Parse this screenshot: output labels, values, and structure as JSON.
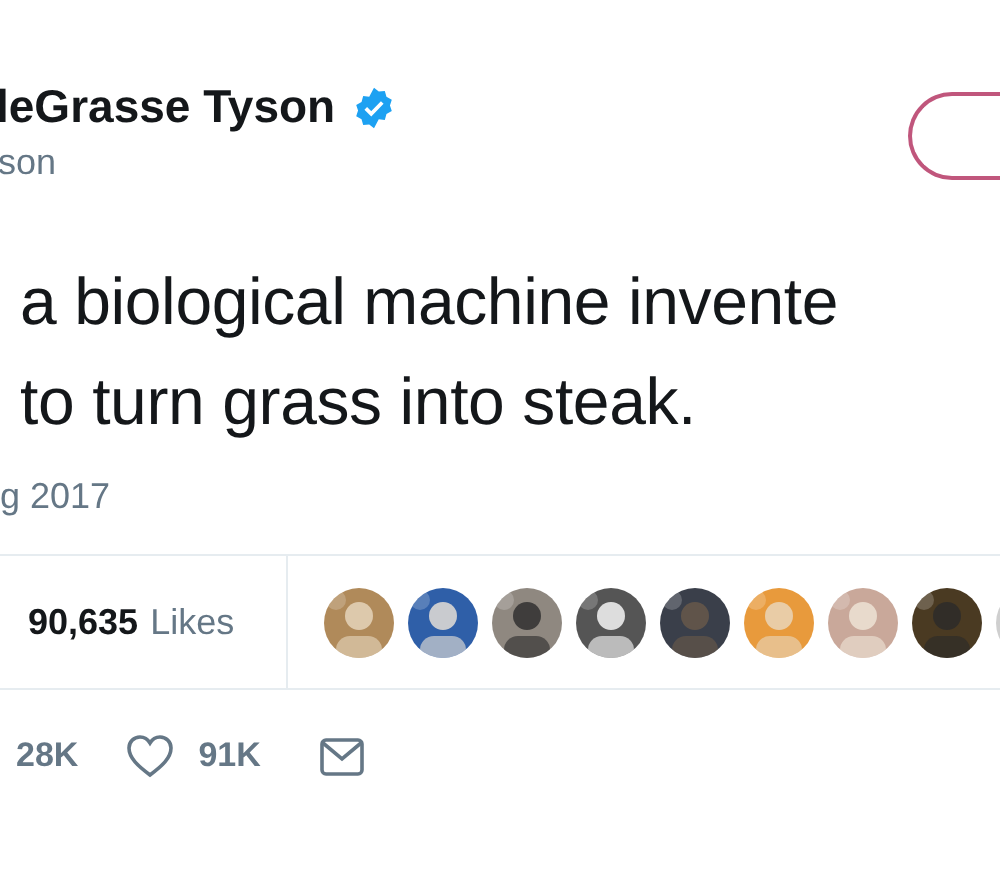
{
  "author": {
    "name": "leGrasse Tyson",
    "verified": true,
    "handle": "son"
  },
  "tweet": {
    "lines": [
      "a biological machine invente",
      "to turn grass into steak."
    ],
    "date": "g 2017"
  },
  "stats": {
    "likes_count": "90,635",
    "likes_label": "Likes"
  },
  "actions": {
    "retweets": "28K",
    "likes": "91K"
  }
}
